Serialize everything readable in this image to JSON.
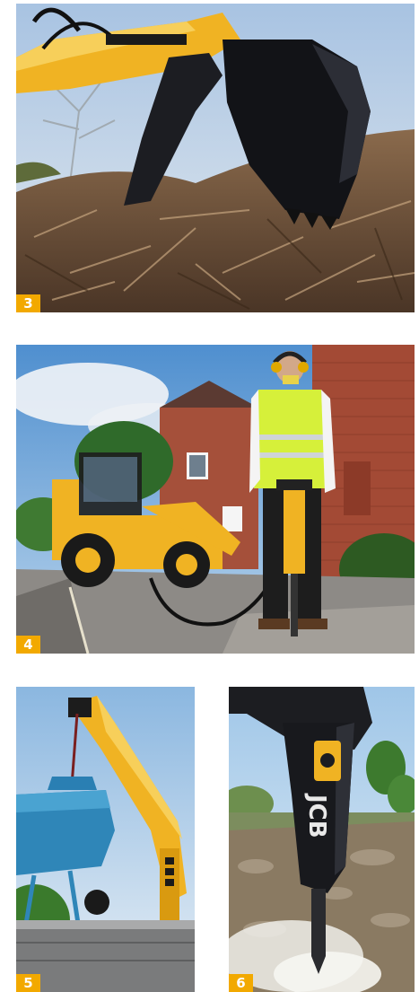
{
  "photos": [
    {
      "number": "3"
    },
    {
      "number": "4"
    },
    {
      "number": "5"
    },
    {
      "number": "6"
    }
  ],
  "colors": {
    "badge": "#f2a900",
    "badge_text": "#ffffff",
    "jcb_yellow": "#f0b323",
    "sky": "#bcd3ea",
    "brick": "#9b4a36",
    "mixer_blue": "#2f86b8"
  }
}
